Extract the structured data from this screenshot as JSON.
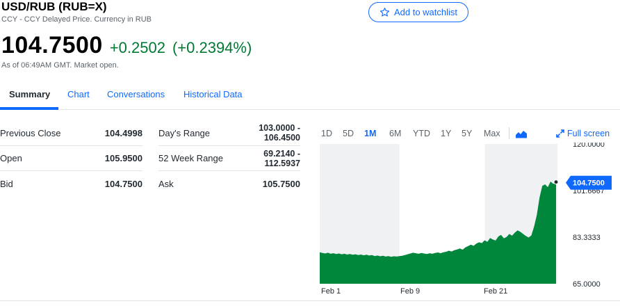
{
  "header": {
    "title": "USD/RUB (RUB=X)",
    "subtitle": "CCY - CCY Delayed Price. Currency in RUB",
    "watchlist_label": "Add to watchlist",
    "price": "104.7500",
    "change": "+0.2502",
    "change_pct": "(+0.2394%)",
    "as_of": "As of 06:49AM GMT. Market open."
  },
  "tabs": [
    "Summary",
    "Chart",
    "Conversations",
    "Historical Data"
  ],
  "stats_left": [
    {
      "label": "Previous Close",
      "value": "104.4998"
    },
    {
      "label": "Open",
      "value": "105.9500"
    },
    {
      "label": "Bid",
      "value": "104.7500"
    }
  ],
  "stats_right": [
    {
      "label": "Day's Range",
      "value1": "103.0000 -",
      "value2": "106.4500"
    },
    {
      "label": "52 Week Range",
      "value1": "69.2140 -",
      "value2": "112.5937"
    },
    {
      "label": "Ask",
      "value1": "105.7500",
      "value2": ""
    }
  ],
  "ranges": [
    "1D",
    "5D",
    "1M",
    "6M",
    "YTD",
    "1Y",
    "5Y",
    "Max"
  ],
  "active_range": "1M",
  "fullscreen_label": "Full screen",
  "colors": {
    "accent": "#0f69ff",
    "positive": "#007a33",
    "area_fill": "#00873c",
    "weekend_shade": "#f0f1f3"
  },
  "chart_data": {
    "type": "area",
    "x_tick_labels": [
      "Feb 1",
      "Feb 9",
      "Feb 21"
    ],
    "y_tick_labels": [
      "120.0000",
      "101.6667",
      "83.3333",
      "65.0000"
    ],
    "ylim": [
      65,
      120
    ],
    "current_label": "104.7500",
    "current_value": 104.75,
    "values": [
      77.4,
      77.1,
      76.9,
      77.2,
      76.8,
      77.0,
      76.7,
      76.9,
      76.6,
      76.8,
      76.5,
      76.7,
      76.4,
      76.6,
      76.3,
      76.5,
      76.2,
      76.4,
      76.1,
      76.3,
      75.9,
      76.1,
      75.8,
      76.0,
      75.7,
      75.9,
      75.6,
      75.8,
      75.7,
      75.9,
      76.0,
      76.3,
      76.6,
      76.9,
      77.2,
      77.0,
      76.8,
      77.1,
      76.9,
      76.7,
      77.0,
      76.8,
      77.1,
      77.3,
      77.0,
      77.4,
      77.6,
      78.0,
      77.7,
      78.2,
      78.5,
      78.9,
      78.4,
      79.3,
      79.8,
      80.4,
      79.9,
      80.8,
      81.3,
      81.0,
      82.1,
      81.5,
      83.0,
      82.4,
      82.0,
      83.6,
      84.2,
      82.9,
      83.4,
      84.6,
      83.9,
      85.1,
      86.0,
      85.4,
      84.6,
      83.8,
      83.2,
      84.0,
      87.5,
      92.0,
      99.0,
      103.5,
      104.1,
      103.0,
      105.2,
      104.3,
      104.75
    ],
    "shaded_bands": [
      [
        0.0,
        0.335
      ],
      [
        0.695,
        1.0
      ]
    ]
  }
}
